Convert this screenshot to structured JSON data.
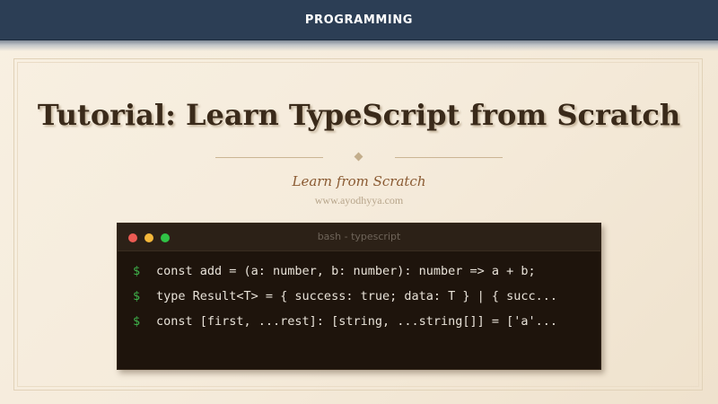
{
  "header": {
    "category_label": "PROGRAMMING"
  },
  "main": {
    "title": "Tutorial: Learn TypeScript from Scratch",
    "subtitle": "Learn from Scratch",
    "site": "www.ayodhyya.com"
  },
  "terminal": {
    "window_title": "bash - typescript",
    "prompt_symbol": "$",
    "lines": [
      "const add = (a: number, b: number): number => a + b;",
      "type Result<T> = { success: true; data: T } | { succ...",
      "const [first, ...rest]: [string, ...string[]] = ['a'..."
    ],
    "window_controls": [
      "close-icon",
      "minimize-icon",
      "maximize-icon"
    ]
  },
  "colors": {
    "header_bg": "#2c3e55",
    "title_text": "#3a2a1a",
    "subtitle_text": "#8a5a32",
    "terminal_bg": "#1e140c",
    "prompt": "#3fb44c",
    "dot_red": "#ec5b53",
    "dot_yellow": "#f3b73a",
    "dot_green": "#30c246"
  }
}
